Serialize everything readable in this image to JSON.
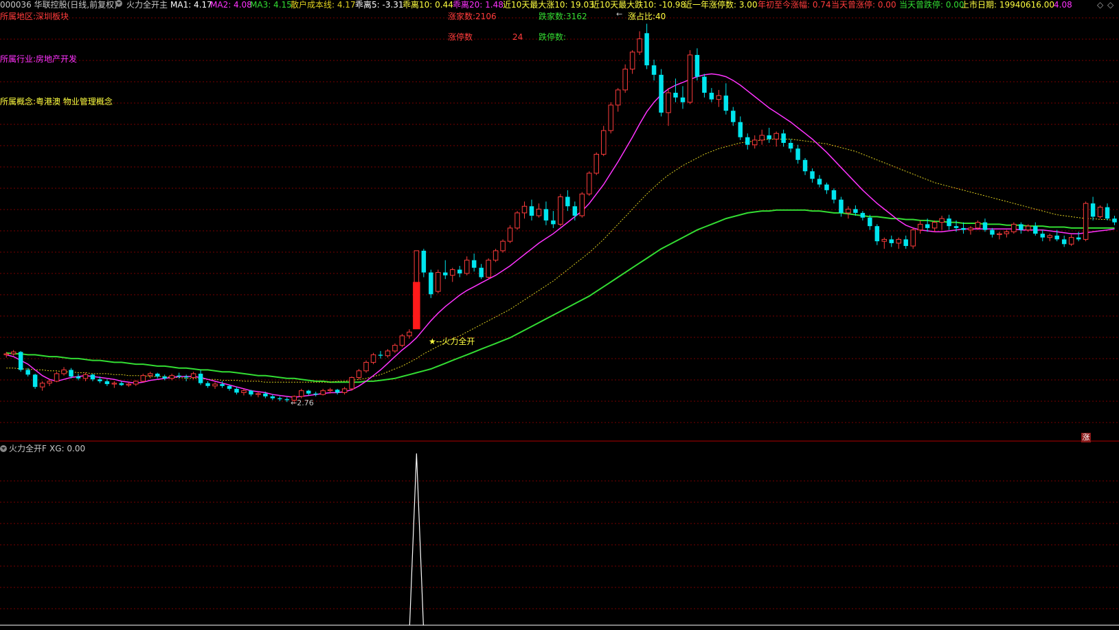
{
  "header": {
    "stock": "000036 华联控股(日线,前复权)",
    "indicator": "火力全开主",
    "ma1": "MA1: 4.17",
    "ma2": "MA2: 4.08",
    "ma3": "MA3: 4.15",
    "cost_line": "散户成本线: 4.17",
    "bias5": "乖离5: -3.31",
    "bias10": "乖离10: 0.44",
    "bias20": "乖离20: 1.48",
    "max_up10": "近10天最大涨10: 19.03",
    "max_down10": "近10天最大跌10: -10.98",
    "limit_up_year": "近一年涨停数: 3.00",
    "ytd": "年初至今涨幅: 0.74",
    "today_limit_up": "当天曾涨停: 0.00",
    "today_limit_down": "当天曾跌停: 0.00",
    "ipo_date": "上市日期: 19940616.00",
    "last": "4.08",
    "nav_left": "◇",
    "nav_right": "◇"
  },
  "info": {
    "region": "所属地区:深圳板块",
    "industry": "所属行业:房地产开发",
    "concept": "所属概念:粤港澳 物业管理概念",
    "up_count": "涨家数:2106",
    "down_count": "跌家数:3162",
    "limit_up_label": "涨停数",
    "limit_up_value": "24",
    "limit_down_label": "跌停数:",
    "up_ratio": "涨占比:40"
  },
  "annotations": {
    "signal": "★--火力全开",
    "low_price": "←2.76",
    "high_marker": "←",
    "badge": "涨"
  },
  "sub": {
    "title": "火力全开F",
    "xg": "XG: 0.00"
  },
  "colors": {
    "up": "#ff3c3c",
    "down": "#00e5ee",
    "ma1": "#ffffff",
    "ma2": "#ff33ff",
    "ma3": "#33dd33",
    "cost": "#e0d020",
    "grid": "#7a0000"
  },
  "chart_data": {
    "type": "candlestick",
    "candles_ohlc": [
      [
        3.28,
        3.31,
        3.25,
        3.29
      ],
      [
        3.29,
        3.33,
        3.27,
        3.31
      ],
      [
        3.31,
        3.32,
        3.1,
        3.12
      ],
      [
        3.12,
        3.14,
        3.05,
        3.07
      ],
      [
        3.07,
        3.08,
        2.92,
        2.94
      ],
      [
        2.94,
        3.0,
        2.9,
        2.98
      ],
      [
        2.98,
        3.02,
        2.95,
        3.0
      ],
      [
        3.0,
        3.1,
        2.99,
        3.08
      ],
      [
        3.08,
        3.15,
        3.06,
        3.12
      ],
      [
        3.12,
        3.14,
        3.03,
        3.05
      ],
      [
        3.05,
        3.08,
        3.01,
        3.03
      ],
      [
        3.03,
        3.09,
        3.0,
        3.07
      ],
      [
        3.07,
        3.08,
        3.0,
        3.02
      ],
      [
        3.02,
        3.05,
        2.98,
        3.0
      ],
      [
        3.0,
        3.02,
        2.95,
        2.97
      ],
      [
        2.97,
        3.0,
        2.93,
        2.98
      ],
      [
        2.98,
        3.0,
        2.95,
        2.96
      ],
      [
        2.96,
        2.99,
        2.94,
        2.97
      ],
      [
        2.97,
        3.01,
        2.95,
        3.0
      ],
      [
        3.0,
        3.08,
        2.99,
        3.06
      ],
      [
        3.06,
        3.1,
        3.03,
        3.08
      ],
      [
        3.08,
        3.09,
        3.03,
        3.05
      ],
      [
        3.05,
        3.07,
        3.01,
        3.03
      ],
      [
        3.03,
        3.08,
        3.01,
        3.06
      ],
      [
        3.06,
        3.09,
        3.03,
        3.05
      ],
      [
        3.05,
        3.07,
        3.0,
        3.04
      ],
      [
        3.04,
        3.1,
        3.02,
        3.08
      ],
      [
        3.08,
        3.12,
        2.96,
        2.98
      ],
      [
        2.98,
        3.0,
        2.93,
        2.95
      ],
      [
        2.95,
        2.99,
        2.92,
        2.97
      ],
      [
        2.97,
        3.0,
        2.93,
        2.95
      ],
      [
        2.95,
        2.96,
        2.9,
        2.92
      ],
      [
        2.92,
        2.94,
        2.86,
        2.88
      ],
      [
        2.88,
        2.92,
        2.85,
        2.9
      ],
      [
        2.9,
        2.91,
        2.84,
        2.86
      ],
      [
        2.86,
        2.89,
        2.83,
        2.87
      ],
      [
        2.87,
        2.89,
        2.82,
        2.84
      ],
      [
        2.84,
        2.86,
        2.8,
        2.82
      ],
      [
        2.82,
        2.84,
        2.79,
        2.81
      ],
      [
        2.81,
        2.83,
        2.78,
        2.8
      ],
      [
        2.8,
        2.85,
        2.76,
        2.84
      ],
      [
        2.84,
        2.92,
        2.82,
        2.9
      ],
      [
        2.9,
        2.91,
        2.85,
        2.87
      ],
      [
        2.87,
        2.89,
        2.84,
        2.86
      ],
      [
        2.86,
        2.92,
        2.85,
        2.9
      ],
      [
        2.9,
        2.93,
        2.87,
        2.91
      ],
      [
        2.91,
        2.92,
        2.86,
        2.88
      ],
      [
        2.88,
        2.94,
        2.86,
        2.92
      ],
      [
        2.92,
        3.05,
        2.9,
        3.04
      ],
      [
        3.04,
        3.13,
        3.02,
        3.11
      ],
      [
        3.11,
        3.22,
        3.09,
        3.2
      ],
      [
        3.2,
        3.3,
        3.18,
        3.28
      ],
      [
        3.28,
        3.32,
        3.24,
        3.27
      ],
      [
        3.27,
        3.34,
        3.25,
        3.32
      ],
      [
        3.32,
        3.4,
        3.3,
        3.38
      ],
      [
        3.38,
        3.5,
        3.36,
        3.48
      ],
      [
        3.48,
        3.55,
        3.45,
        3.52
      ],
      [
        3.8,
        4.38,
        3.78,
        4.38
      ],
      [
        4.38,
        4.4,
        4.1,
        4.15
      ],
      [
        4.15,
        4.18,
        3.88,
        3.92
      ],
      [
        3.95,
        4.18,
        3.93,
        4.15
      ],
      [
        4.15,
        4.28,
        4.08,
        4.12
      ],
      [
        4.12,
        4.2,
        4.05,
        4.18
      ],
      [
        4.18,
        4.22,
        4.1,
        4.14
      ],
      [
        4.14,
        4.32,
        4.12,
        4.28
      ],
      [
        4.28,
        4.35,
        4.16,
        4.2
      ],
      [
        4.2,
        4.24,
        4.08,
        4.1
      ],
      [
        4.1,
        4.3,
        4.08,
        4.28
      ],
      [
        4.28,
        4.4,
        4.26,
        4.38
      ],
      [
        4.38,
        4.5,
        4.36,
        4.48
      ],
      [
        4.48,
        4.65,
        4.46,
        4.62
      ],
      [
        4.62,
        4.8,
        4.6,
        4.78
      ],
      [
        4.78,
        4.9,
        4.72,
        4.85
      ],
      [
        4.85,
        4.92,
        4.7,
        4.75
      ],
      [
        4.75,
        4.88,
        4.73,
        4.82
      ],
      [
        4.82,
        4.9,
        4.65,
        4.7
      ],
      [
        4.7,
        4.8,
        4.62,
        4.66
      ],
      [
        4.66,
        4.98,
        4.64,
        4.95
      ],
      [
        4.95,
        5.02,
        4.8,
        4.85
      ],
      [
        4.85,
        4.9,
        4.7,
        4.75
      ],
      [
        4.75,
        5.0,
        4.73,
        4.98
      ],
      [
        4.98,
        5.22,
        4.96,
        5.2
      ],
      [
        5.2,
        5.42,
        5.18,
        5.4
      ],
      [
        5.4,
        5.7,
        5.38,
        5.65
      ],
      [
        5.65,
        5.95,
        5.62,
        5.92
      ],
      [
        5.92,
        6.1,
        5.85,
        6.08
      ],
      [
        6.08,
        6.35,
        6.05,
        6.3
      ],
      [
        6.3,
        6.5,
        6.25,
        6.48
      ],
      [
        6.48,
        6.7,
        6.45,
        6.62
      ],
      [
        6.68,
        6.78,
        6.3,
        6.34
      ],
      [
        6.34,
        6.4,
        6.18,
        6.24
      ],
      [
        6.24,
        6.3,
        5.8,
        5.84
      ],
      [
        5.84,
        6.1,
        5.7,
        6.05
      ],
      [
        6.05,
        6.2,
        5.95,
        6.0
      ],
      [
        6.0,
        6.12,
        5.88,
        5.95
      ],
      [
        5.95,
        6.5,
        5.93,
        6.45
      ],
      [
        6.45,
        6.52,
        6.18,
        6.22
      ],
      [
        6.22,
        6.25,
        6.0,
        6.05
      ],
      [
        6.05,
        6.1,
        5.95,
        5.98
      ],
      [
        5.98,
        6.08,
        5.9,
        6.02
      ],
      [
        6.02,
        6.15,
        5.82,
        5.86
      ],
      [
        5.86,
        5.9,
        5.7,
        5.74
      ],
      [
        5.74,
        5.8,
        5.55,
        5.58
      ],
      [
        5.58,
        5.62,
        5.45,
        5.5
      ],
      [
        5.5,
        5.6,
        5.46,
        5.55
      ],
      [
        5.55,
        5.66,
        5.5,
        5.6
      ],
      [
        5.6,
        5.68,
        5.52,
        5.56
      ],
      [
        5.56,
        5.64,
        5.48,
        5.62
      ],
      [
        5.62,
        5.66,
        5.48,
        5.52
      ],
      [
        5.52,
        5.56,
        5.42,
        5.46
      ],
      [
        5.46,
        5.5,
        5.3,
        5.34
      ],
      [
        5.34,
        5.36,
        5.18,
        5.22
      ],
      [
        5.22,
        5.25,
        5.1,
        5.14
      ],
      [
        5.14,
        5.18,
        5.05,
        5.08
      ],
      [
        5.08,
        5.1,
        4.98,
        5.02
      ],
      [
        5.02,
        5.04,
        4.88,
        4.92
      ],
      [
        4.92,
        4.95,
        4.74,
        4.78
      ],
      [
        4.78,
        4.85,
        4.72,
        4.82
      ],
      [
        4.82,
        4.86,
        4.75,
        4.78
      ],
      [
        4.78,
        4.8,
        4.7,
        4.73
      ],
      [
        4.73,
        4.76,
        4.6,
        4.64
      ],
      [
        4.64,
        4.66,
        4.44,
        4.48
      ],
      [
        4.48,
        4.52,
        4.4,
        4.5
      ],
      [
        4.5,
        4.54,
        4.42,
        4.46
      ],
      [
        4.46,
        4.52,
        4.4,
        4.5
      ],
      [
        4.5,
        4.54,
        4.4,
        4.43
      ],
      [
        4.43,
        4.62,
        4.4,
        4.6
      ],
      [
        4.6,
        4.7,
        4.56,
        4.66
      ],
      [
        4.66,
        4.72,
        4.58,
        4.62
      ],
      [
        4.62,
        4.7,
        4.58,
        4.68
      ],
      [
        4.68,
        4.75,
        4.6,
        4.72
      ],
      [
        4.72,
        4.76,
        4.6,
        4.64
      ],
      [
        4.64,
        4.7,
        4.58,
        4.62
      ],
      [
        4.62,
        4.68,
        4.56,
        4.6
      ],
      [
        4.6,
        4.64,
        4.55,
        4.62
      ],
      [
        4.62,
        4.7,
        4.6,
        4.68
      ],
      [
        4.68,
        4.72,
        4.58,
        4.6
      ],
      [
        4.6,
        4.62,
        4.52,
        4.55
      ],
      [
        4.55,
        4.58,
        4.5,
        4.56
      ],
      [
        4.56,
        4.6,
        4.52,
        4.58
      ],
      [
        4.58,
        4.68,
        4.56,
        4.66
      ],
      [
        4.66,
        4.68,
        4.56,
        4.6
      ],
      [
        4.6,
        4.66,
        4.58,
        4.64
      ],
      [
        4.64,
        4.68,
        4.54,
        4.56
      ],
      [
        4.56,
        4.6,
        4.48,
        4.52
      ],
      [
        4.52,
        4.56,
        4.48,
        4.54
      ],
      [
        4.54,
        4.6,
        4.48,
        4.5
      ],
      [
        4.5,
        4.54,
        4.42,
        4.45
      ],
      [
        4.45,
        4.55,
        4.43,
        4.52
      ],
      [
        4.52,
        4.58,
        4.48,
        4.5
      ],
      [
        4.5,
        4.9,
        4.48,
        4.88
      ],
      [
        4.88,
        4.95,
        4.7,
        4.74
      ],
      [
        4.74,
        4.86,
        4.72,
        4.84
      ],
      [
        4.84,
        4.88,
        4.7,
        4.72
      ],
      [
        4.72,
        4.75,
        4.65,
        4.68
      ]
    ],
    "ma1": [
      3.28,
      3.26,
      3.22,
      3.18,
      3.12,
      3.06,
      3.02,
      3.0,
      3.02,
      3.04,
      3.05,
      3.06,
      3.05,
      3.04,
      3.03,
      3.02,
      3.0,
      2.99,
      2.98,
      2.99,
      3.01,
      3.02,
      3.03,
      3.04,
      3.05,
      3.05,
      3.05,
      3.04,
      3.02,
      3.0,
      2.98,
      2.96,
      2.94,
      2.92,
      2.9,
      2.89,
      2.88,
      2.86,
      2.85,
      2.84,
      2.83,
      2.84,
      2.85,
      2.86,
      2.87,
      2.88,
      2.88,
      2.89,
      2.91,
      2.95,
      3.0,
      3.06,
      3.12,
      3.19,
      3.26,
      3.33,
      3.39,
      3.46,
      3.55,
      3.64,
      3.72,
      3.79,
      3.85,
      3.91,
      3.96,
      4.0,
      4.04,
      4.08,
      4.12,
      4.17,
      4.22,
      4.28,
      4.34,
      4.4,
      4.46,
      4.51,
      4.56,
      4.62,
      4.68,
      4.74,
      4.8,
      4.88,
      4.98,
      5.08,
      5.2,
      5.32,
      5.45,
      5.58,
      5.72,
      5.85,
      5.95,
      6.03,
      6.09,
      6.13,
      6.16,
      6.19,
      6.22,
      6.24,
      6.25,
      6.24,
      6.22,
      6.18,
      6.13,
      6.07,
      6.01,
      5.95,
      5.89,
      5.84,
      5.79,
      5.74,
      5.68,
      5.62,
      5.56,
      5.49,
      5.42,
      5.34,
      5.26,
      5.18,
      5.1,
      5.02,
      4.95,
      4.88,
      4.82,
      4.76,
      4.7,
      4.65,
      4.62,
      4.6,
      4.59,
      4.58,
      4.58,
      4.59,
      4.6,
      4.61,
      4.61,
      4.61,
      4.61,
      4.61,
      4.61,
      4.61,
      4.61,
      4.6,
      4.6,
      4.6,
      4.6,
      4.59,
      4.58,
      4.57,
      4.56,
      4.56,
      4.57,
      4.58,
      4.59,
      4.6,
      4.61
    ],
    "ma2_cost": [
      3.14,
      3.14,
      3.13,
      3.13,
      3.12,
      3.12,
      3.11,
      3.11,
      3.1,
      3.1,
      3.09,
      3.09,
      3.08,
      3.08,
      3.08,
      3.07,
      3.07,
      3.06,
      3.06,
      3.06,
      3.05,
      3.05,
      3.05,
      3.04,
      3.04,
      3.03,
      3.03,
      3.03,
      3.02,
      3.02,
      3.01,
      3.01,
      3.01,
      3.0,
      3.0,
      3.0,
      2.99,
      2.99,
      2.99,
      2.99,
      2.99,
      2.99,
      2.99,
      2.99,
      2.99,
      2.99,
      3.0,
      3.0,
      3.01,
      3.02,
      3.03,
      3.05,
      3.07,
      3.1,
      3.13,
      3.16,
      3.2,
      3.24,
      3.29,
      3.33,
      3.37,
      3.41,
      3.45,
      3.48,
      3.52,
      3.56,
      3.6,
      3.64,
      3.68,
      3.72,
      3.76,
      3.81,
      3.86,
      3.91,
      3.96,
      4.01,
      4.06,
      4.12,
      4.18,
      4.24,
      4.3,
      4.36,
      4.43,
      4.5,
      4.58,
      4.66,
      4.74,
      4.82,
      4.9,
      4.98,
      5.05,
      5.12,
      5.18,
      5.23,
      5.28,
      5.32,
      5.36,
      5.4,
      5.43,
      5.46,
      5.48,
      5.5,
      5.52,
      5.53,
      5.54,
      5.55,
      5.56,
      5.56,
      5.56,
      5.56,
      5.55,
      5.54,
      5.53,
      5.52,
      5.51,
      5.49,
      5.47,
      5.45,
      5.43,
      5.4,
      5.37,
      5.34,
      5.31,
      5.28,
      5.25,
      5.22,
      5.19,
      5.16,
      5.13,
      5.1,
      5.08,
      5.06,
      5.04,
      5.02,
      5.0,
      4.98,
      4.96,
      4.94,
      4.92,
      4.9,
      4.88,
      4.86,
      4.84,
      4.82,
      4.8,
      4.78,
      4.76,
      4.75,
      4.74,
      4.73,
      4.72,
      4.72,
      4.71,
      4.71,
      4.7
    ],
    "ma3": [
      3.3,
      3.29,
      3.29,
      3.28,
      3.28,
      3.27,
      3.26,
      3.26,
      3.25,
      3.24,
      3.24,
      3.23,
      3.22,
      3.22,
      3.21,
      3.2,
      3.2,
      3.19,
      3.18,
      3.18,
      3.17,
      3.16,
      3.16,
      3.15,
      3.14,
      3.14,
      3.13,
      3.12,
      3.12,
      3.11,
      3.1,
      3.1,
      3.09,
      3.08,
      3.07,
      3.06,
      3.06,
      3.05,
      3.04,
      3.03,
      3.03,
      3.02,
      3.01,
      3.0,
      3.0,
      2.99,
      2.99,
      2.99,
      2.99,
      2.99,
      3.0,
      3.0,
      3.01,
      3.02,
      3.03,
      3.05,
      3.07,
      3.09,
      3.11,
      3.13,
      3.16,
      3.19,
      3.22,
      3.25,
      3.28,
      3.31,
      3.34,
      3.37,
      3.4,
      3.43,
      3.46,
      3.5,
      3.54,
      3.58,
      3.62,
      3.66,
      3.7,
      3.74,
      3.78,
      3.82,
      3.86,
      3.9,
      3.95,
      4.0,
      4.05,
      4.1,
      4.15,
      4.2,
      4.25,
      4.3,
      4.35,
      4.4,
      4.44,
      4.48,
      4.52,
      4.56,
      4.6,
      4.63,
      4.66,
      4.69,
      4.72,
      4.74,
      4.76,
      4.78,
      4.79,
      4.8,
      4.8,
      4.81,
      4.81,
      4.81,
      4.81,
      4.81,
      4.8,
      4.8,
      4.79,
      4.78,
      4.78,
      4.77,
      4.76,
      4.75,
      4.74,
      4.74,
      4.73,
      4.72,
      4.72,
      4.71,
      4.71,
      4.7,
      4.7,
      4.69,
      4.69,
      4.68,
      4.68,
      4.67,
      4.67,
      4.67,
      4.66,
      4.66,
      4.66,
      4.65,
      4.65,
      4.65,
      4.64,
      4.64,
      4.64,
      4.63,
      4.63,
      4.63,
      4.62,
      4.62,
      4.62,
      4.62,
      4.62,
      4.62,
      4.62
    ],
    "signal_index": 57,
    "xg_series_peak": 1.0
  }
}
